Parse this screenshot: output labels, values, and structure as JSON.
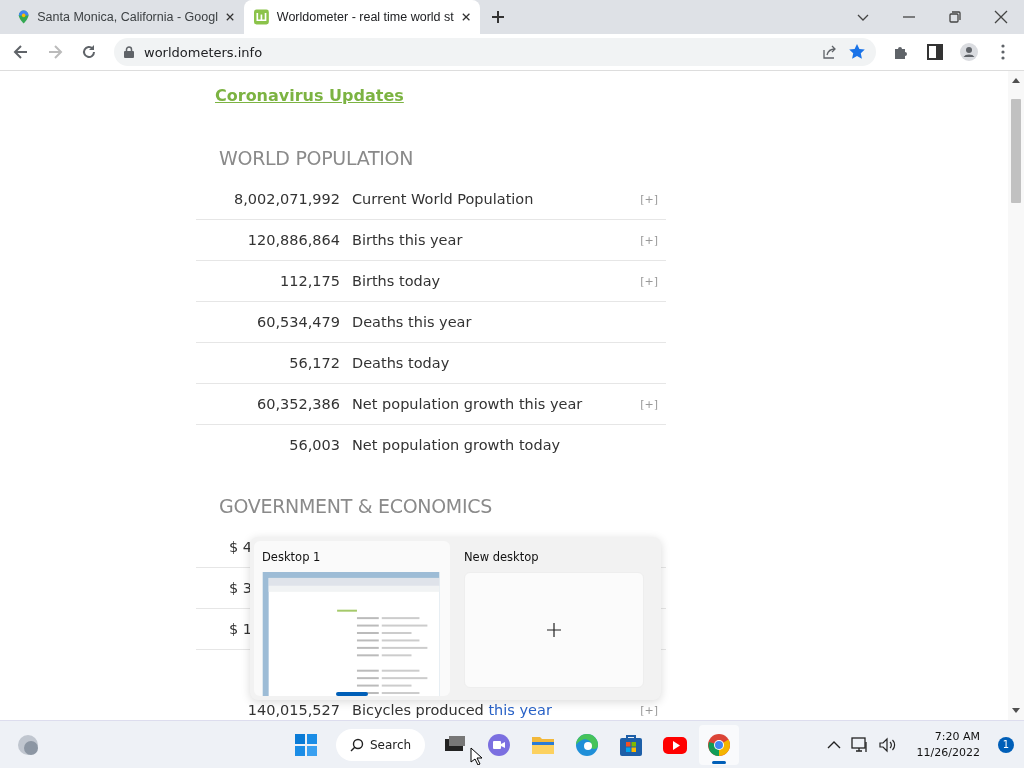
{
  "browser": {
    "tabs": [
      {
        "title": "Santa Monica, California - Googl",
        "selected": false
      },
      {
        "title": "Worldometer - real time world st",
        "selected": true
      }
    ],
    "address": "worldometers.info",
    "bookmarked": true
  },
  "page": {
    "top_link": "Coronavirus Updates",
    "sections": [
      {
        "heading": "WORLD POPULATION",
        "rows": [
          {
            "value": "8,002,071,992",
            "label": "Current World Population",
            "expand": "[+]"
          },
          {
            "value": "120,886,864",
            "label": "Births this year",
            "expand": "[+]"
          },
          {
            "value": "112,175",
            "label": "Births today",
            "expand": "[+]"
          },
          {
            "value": "60,534,479",
            "label": "Deaths this year"
          },
          {
            "value": "56,172",
            "label": "Deaths today"
          },
          {
            "value": "60,352,386",
            "label": "Net population growth this year",
            "expand": "[+]"
          },
          {
            "value": "56,003",
            "label": "Net population growth today"
          }
        ]
      },
      {
        "heading": "GOVERNMENT & ECONOMICS",
        "rows": [
          {
            "value": "$ 4",
            "kind": "cut"
          },
          {
            "value": "$ 3",
            "kind": "cut"
          },
          {
            "value": "$ 1",
            "kind": "cut"
          },
          {
            "value": "140,015,527",
            "label": "Bicycles produced",
            "link": "this year",
            "expand": "[+]",
            "kind": "full"
          }
        ]
      }
    ]
  },
  "desktops": [
    {
      "name": "Desktop 1",
      "kind": "desktop",
      "selected": true
    },
    {
      "name": "New desktop",
      "kind": "new",
      "selected": false
    }
  ],
  "taskbar": {
    "apps": [
      {
        "kind": "start",
        "selected": false
      },
      {
        "kind": "search",
        "label": "Search",
        "selected": false
      },
      {
        "kind": "taskview",
        "selected": false
      },
      {
        "kind": "chat",
        "selected": false
      },
      {
        "kind": "folder",
        "selected": false
      },
      {
        "kind": "edge",
        "selected": false
      },
      {
        "kind": "store",
        "selected": false
      },
      {
        "kind": "youtube",
        "selected": false
      },
      {
        "kind": "chrome",
        "selected": true
      }
    ],
    "time": "7:20 AM",
    "date": "11/26/2022",
    "notifications": "1"
  }
}
